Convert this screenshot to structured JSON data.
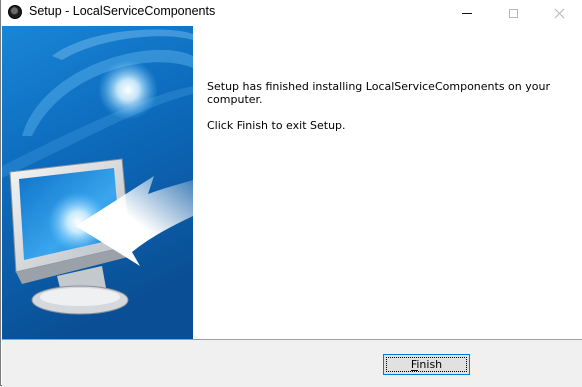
{
  "window": {
    "title": "Setup - LocalServiceComponents",
    "icon": "setup-disc-icon",
    "controls": [
      "minimize-icon",
      "maximize-icon",
      "close-icon"
    ]
  },
  "main": {
    "finished_message": "Setup has finished installing LocalServiceComponents on your computer.",
    "exit_hint": "Click Finish to exit Setup."
  },
  "footer": {
    "finish_label": "Finish",
    "finish_accelerator": "F"
  },
  "colors": {
    "accent": "#0078d7",
    "banner_blue": "#0a6fc4"
  }
}
